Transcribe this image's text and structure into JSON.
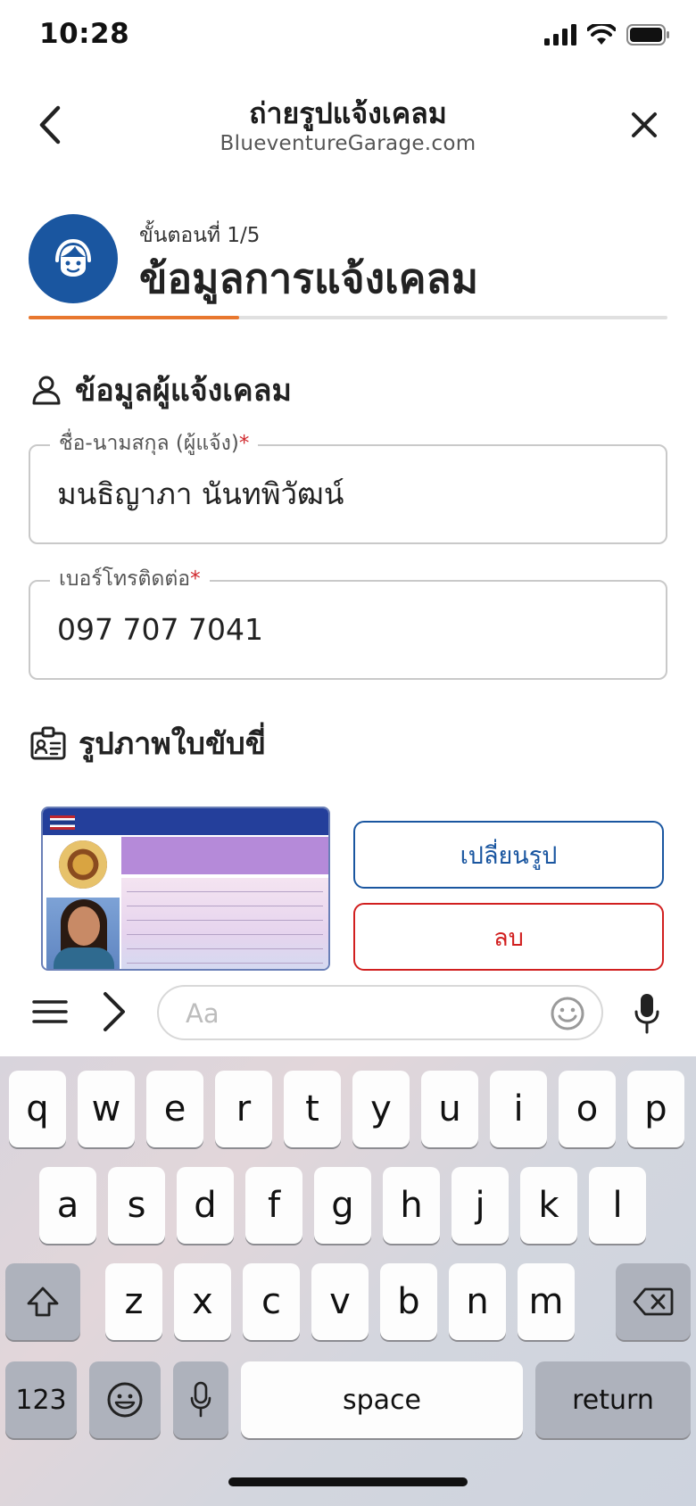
{
  "status_bar": {
    "time": "10:28"
  },
  "header": {
    "title": "ถ่ายรูปแจ้งเคลม",
    "subtitle": "BlueventureGarage.com"
  },
  "step": {
    "label": "ขั้นตอนที่ 1/5",
    "title": "ข้อมูลการแจ้งเคลม",
    "current": 1,
    "total": 5,
    "progress_fraction": 0.33
  },
  "reporter_section": {
    "heading": "ข้อมูลผู้แจ้งเคลม",
    "name_field": {
      "label": "ชื่อ-นามสกุล (ผู้แจ้ง)",
      "required_mark": "*",
      "value": "มนธิญาภา นันทพิวัฒน์"
    },
    "phone_field": {
      "label": "เบอร์โทรติดต่อ",
      "required_mark": "*",
      "value": "097 707 7041"
    }
  },
  "license_section": {
    "heading": "รูปภาพใบขับขี่",
    "change_button": "เปลี่ยนรูป",
    "delete_button": "ลบ"
  },
  "chat_bar": {
    "placeholder": "Aa"
  },
  "keyboard": {
    "row1": [
      "q",
      "w",
      "e",
      "r",
      "t",
      "y",
      "u",
      "i",
      "o",
      "p"
    ],
    "row2": [
      "a",
      "s",
      "d",
      "f",
      "g",
      "h",
      "j",
      "k",
      "l"
    ],
    "row3": [
      "z",
      "x",
      "c",
      "v",
      "b",
      "n",
      "m"
    ],
    "numbers_key": "123",
    "space_key": "space",
    "return_key": "return"
  },
  "colors": {
    "brand_blue": "#1a56a0",
    "progress_orange": "#e8772e",
    "danger_red": "#d11f1f",
    "required_red": "#d0262b"
  }
}
